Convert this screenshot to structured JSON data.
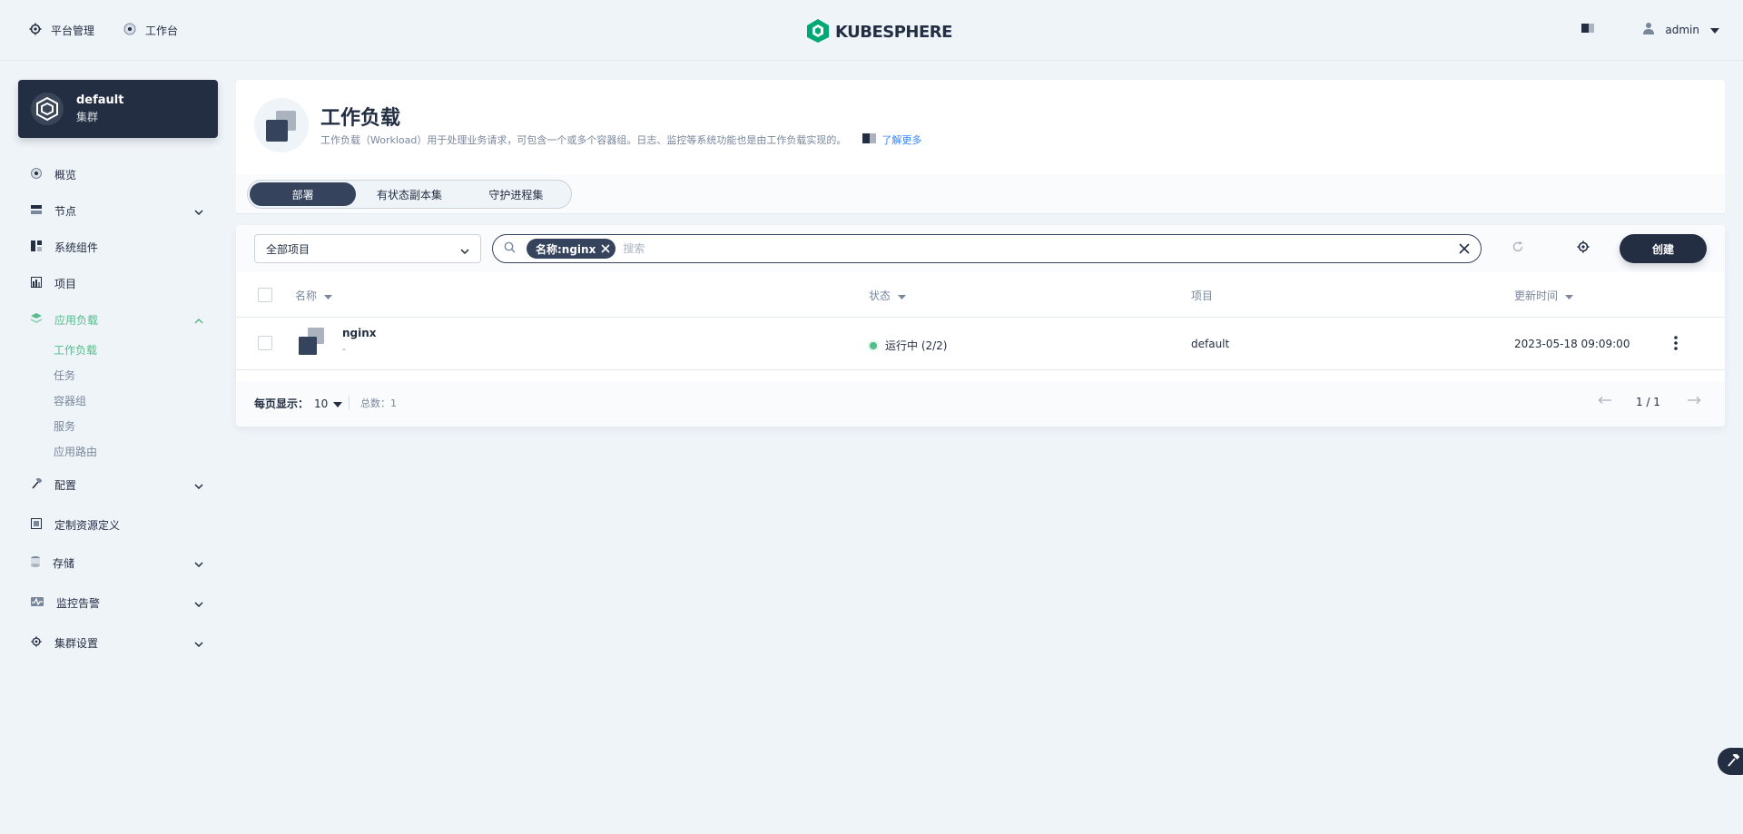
{
  "header": {
    "nav": [
      {
        "label": "平台管理",
        "icon": "gear-icon"
      },
      {
        "label": "工作台",
        "icon": "compass-icon"
      }
    ],
    "brand": "KUBESPHERE",
    "user": "admin"
  },
  "cluster": {
    "name": "default",
    "type": "集群"
  },
  "sidebar": {
    "items": [
      {
        "label": "概览"
      },
      {
        "label": "节点"
      },
      {
        "label": "系统组件"
      },
      {
        "label": "项目"
      },
      {
        "label": "应用负载"
      },
      {
        "label": "配置"
      },
      {
        "label": "定制资源定义"
      },
      {
        "label": "存储"
      },
      {
        "label": "监控告警"
      },
      {
        "label": "集群设置"
      }
    ],
    "workload_sub": [
      {
        "label": "工作负载"
      },
      {
        "label": "任务"
      },
      {
        "label": "容器组"
      },
      {
        "label": "服务"
      },
      {
        "label": "应用路由"
      }
    ]
  },
  "page": {
    "title": "工作负载",
    "description": "工作负载（Workload）用于处理业务请求，可包含一个或多个容器组。日志、监控等系统功能也是由工作负载实现的。",
    "learn_more": "了解更多"
  },
  "tabs": [
    {
      "label": "部署",
      "active": true
    },
    {
      "label": "有状态副本集",
      "active": false
    },
    {
      "label": "守护进程集",
      "active": false
    }
  ],
  "toolbar": {
    "project_filter": "全部项目",
    "filter_tag": "名称:nginx",
    "search_placeholder": "搜索",
    "create_label": "创建"
  },
  "table": {
    "columns": {
      "name": "名称",
      "status": "状态",
      "project": "项目",
      "updated": "更新时间"
    },
    "rows": [
      {
        "name": "nginx",
        "desc": "-",
        "status": "运行中 (2/2)",
        "project": "default",
        "updated": "2023-05-18 09:09:00"
      }
    ]
  },
  "pagination": {
    "per_page_label": "每页显示：",
    "per_page_value": "10",
    "total": "总数：1",
    "page": "1 / 1"
  },
  "colors": {
    "accent": "#55bc8a",
    "dark": "#242e42",
    "background": "#eff4f9"
  }
}
